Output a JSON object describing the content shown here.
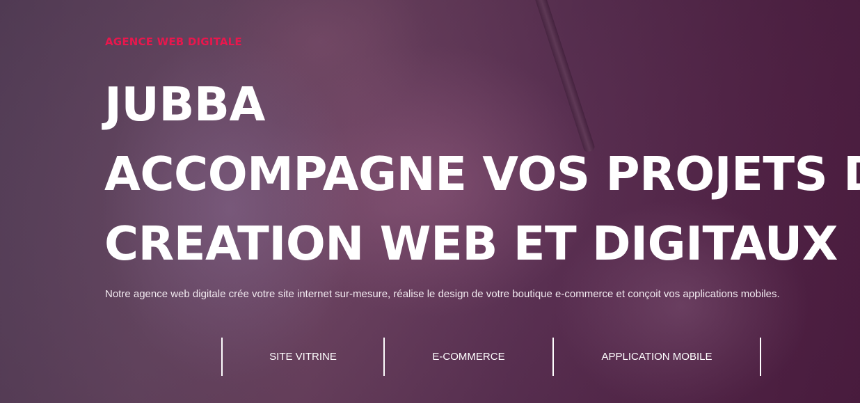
{
  "hero": {
    "eyebrow": "AGENCE WEB DIGITALE",
    "title_lines": [
      "JUBBA",
      "ACCOMPAGNE VOS PROJETS DE",
      "CREATION WEB ET DIGITAUX"
    ],
    "description": "Notre agence web digitale crée votre site internet sur-mesure, réalise le design de votre boutique e-commerce et conçoit vos applications mobiles."
  },
  "services": [
    {
      "label": "SITE VITRINE"
    },
    {
      "label": "E-COMMERCE"
    },
    {
      "label": "APPLICATION MOBILE"
    }
  ],
  "colors": {
    "accent": "#e8174d",
    "text": "#ffffff",
    "overlay": "#5a2a50"
  }
}
